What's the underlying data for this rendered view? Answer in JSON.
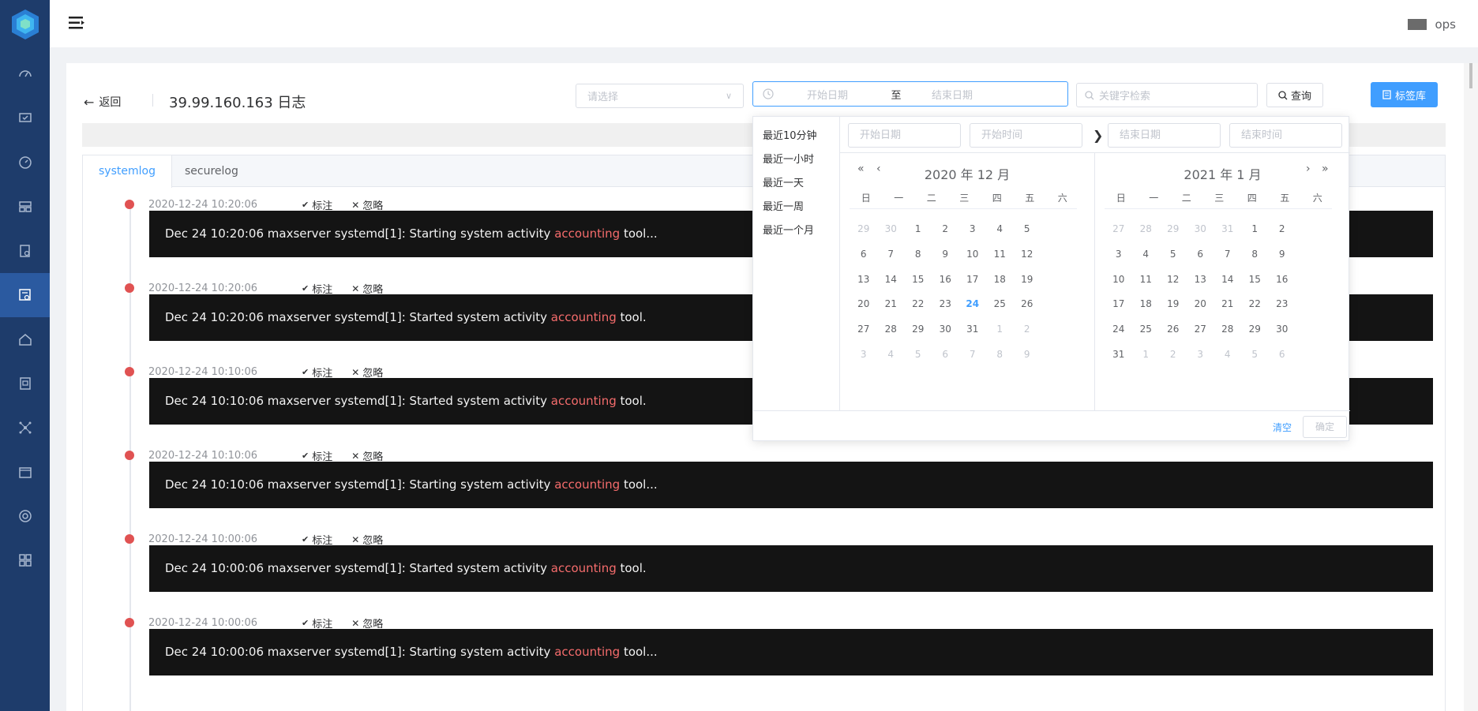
{
  "header": {
    "username": "ops"
  },
  "page": {
    "back_label": "返回",
    "title": "39.99.160.163 日志"
  },
  "filters": {
    "select_placeholder": "请选择",
    "start_placeholder": "开始日期",
    "range_separator": "至",
    "end_placeholder": "结束日期",
    "keyword_placeholder": "关键字检索",
    "query_label": "查询",
    "tag_label": "标签库"
  },
  "tabs": [
    {
      "label": "systemlog"
    },
    {
      "label": "securelog"
    }
  ],
  "actions": {
    "mark": "标注",
    "ignore": "忽略"
  },
  "logs": [
    {
      "time": "2020-12-24 10:20:06",
      "pre": "Dec 24 10:20:06 maxserver systemd[1]: Starting system activity ",
      "kw": "accounting",
      "post": " tool..."
    },
    {
      "time": "2020-12-24 10:20:06",
      "pre": "Dec 24 10:20:06 maxserver systemd[1]: Started system activity ",
      "kw": "accounting",
      "post": " tool."
    },
    {
      "time": "2020-12-24 10:10:06",
      "pre": "Dec 24 10:10:06 maxserver systemd[1]: Started system activity ",
      "kw": "accounting",
      "post": " tool."
    },
    {
      "time": "2020-12-24 10:10:06",
      "pre": "Dec 24 10:10:06 maxserver systemd[1]: Starting system activity ",
      "kw": "accounting",
      "post": " tool..."
    },
    {
      "time": "2020-12-24 10:00:06",
      "pre": "Dec 24 10:00:06 maxserver systemd[1]: Started system activity ",
      "kw": "accounting",
      "post": " tool."
    },
    {
      "time": "2020-12-24 10:00:06",
      "pre": "Dec 24 10:00:06 maxserver systemd[1]: Starting system activity ",
      "kw": "accounting",
      "post": " tool..."
    }
  ],
  "picker": {
    "shortcuts": [
      "最近10分钟",
      "最近一小时",
      "最近一天",
      "最近一周",
      "最近一个月"
    ],
    "start_date_placeholder": "开始日期",
    "start_time_placeholder": "开始时间",
    "end_date_placeholder": "结束日期",
    "end_time_placeholder": "结束时间",
    "weekdays": [
      "日",
      "一",
      "二",
      "三",
      "四",
      "五",
      "六"
    ],
    "left_title": "2020 年 12 月",
    "right_title": "2021 年 1 月",
    "left_days": [
      [
        "29",
        "30",
        "1",
        "2",
        "3",
        "4",
        "5"
      ],
      [
        "6",
        "7",
        "8",
        "9",
        "10",
        "11",
        "12"
      ],
      [
        "13",
        "14",
        "15",
        "16",
        "17",
        "18",
        "19"
      ],
      [
        "20",
        "21",
        "22",
        "23",
        "24",
        "25",
        "26"
      ],
      [
        "27",
        "28",
        "29",
        "30",
        "31",
        "1",
        "2"
      ],
      [
        "3",
        "4",
        "5",
        "6",
        "7",
        "8",
        "9"
      ]
    ],
    "right_days": [
      [
        "27",
        "28",
        "29",
        "30",
        "31",
        "1",
        "2"
      ],
      [
        "3",
        "4",
        "5",
        "6",
        "7",
        "8",
        "9"
      ],
      [
        "10",
        "11",
        "12",
        "13",
        "14",
        "15",
        "16"
      ],
      [
        "17",
        "18",
        "19",
        "20",
        "21",
        "22",
        "23"
      ],
      [
        "24",
        "25",
        "26",
        "27",
        "28",
        "29",
        "30"
      ],
      [
        "31",
        "1",
        "2",
        "3",
        "4",
        "5",
        "6"
      ]
    ],
    "today": "24",
    "clear_label": "清空",
    "ok_label": "确定"
  },
  "colors": {
    "sidebar": "#1e3c6b",
    "accent": "#409eff",
    "highlight": "#f56c6c",
    "dot": "#e05252"
  }
}
